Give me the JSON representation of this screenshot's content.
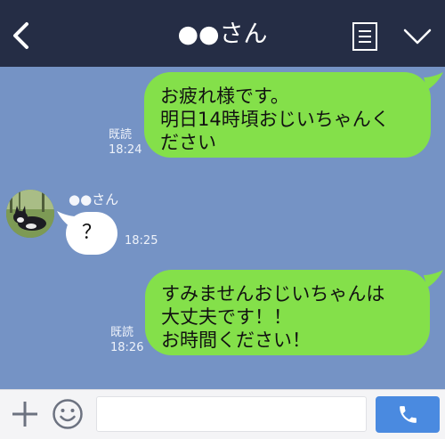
{
  "header": {
    "title": "●●さん"
  },
  "messages": [
    {
      "side": "out",
      "lines": [
        "お疲れ様です。",
        "明日14時頃おじいちゃんく",
        "ださい"
      ],
      "read": "既読",
      "time": "18:24"
    },
    {
      "side": "in",
      "sender": "●●さん",
      "text": "？",
      "time": "18:25"
    },
    {
      "side": "out",
      "lines": [
        "すみませんおじいちゃんは",
        "大丈夫です！！",
        "お時間ください！"
      ],
      "read": "既読",
      "time": "18:26"
    }
  ],
  "input": {
    "placeholder": ""
  },
  "colors": {
    "header": "#252d45",
    "background": "#7593c5",
    "bubble_out": "#84e04a",
    "bubble_in": "#ffffff",
    "call_button": "#4a8ae0"
  },
  "icons": [
    "back-icon",
    "notes-icon",
    "chevron-down-icon",
    "plus-icon",
    "emoji-icon",
    "phone-icon"
  ]
}
